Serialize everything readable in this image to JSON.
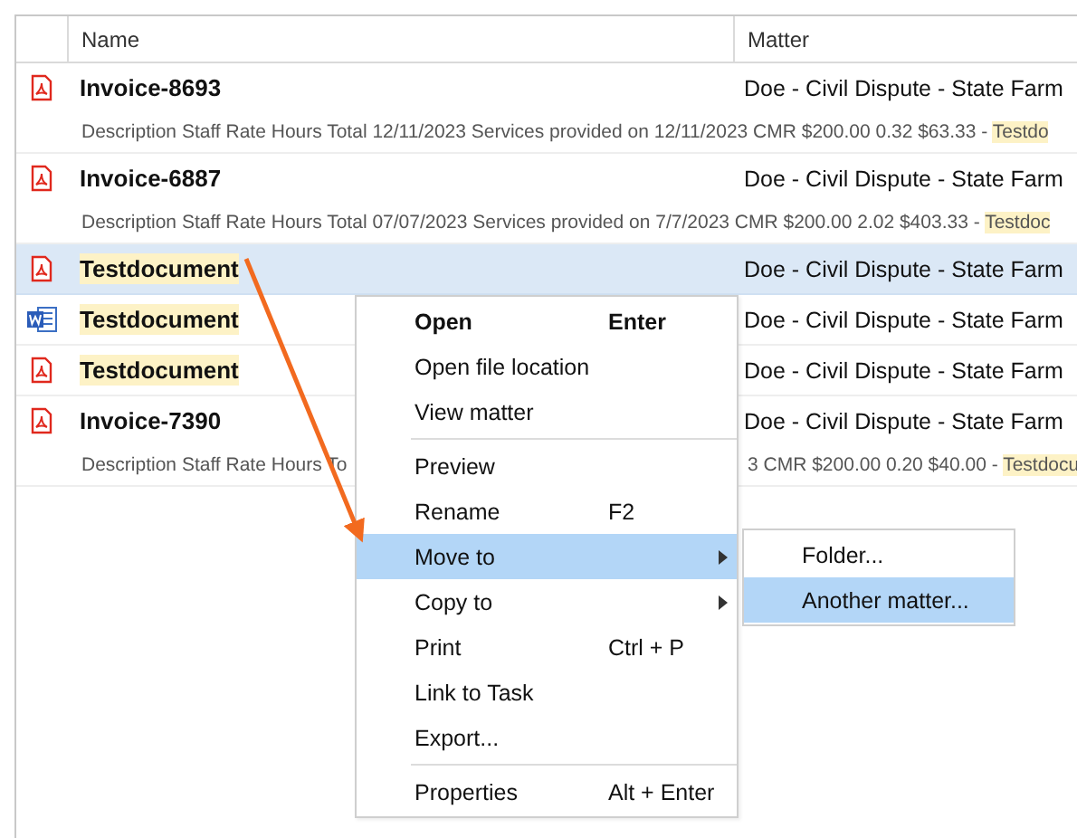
{
  "table": {
    "columns": [
      {
        "label": "Name"
      },
      {
        "label": "Matter"
      }
    ],
    "rows": [
      {
        "kind": "pdf",
        "name": "Invoice-8693",
        "highlighted": false,
        "selected": false,
        "matter": "Doe - Civil Dispute - State Farm",
        "description": [
          {
            "text": "Description Staff Rate Hours Total 12/11/2023 Services provided on 12/11/2023 CMR $200.00 0.32 $63.33 - ",
            "highlight": "Testdo"
          }
        ]
      },
      {
        "kind": "pdf",
        "name": "Invoice-6887",
        "highlighted": false,
        "selected": false,
        "matter": "Doe - Civil Dispute - State Farm",
        "description": [
          {
            "text": "Description Staff Rate Hours Total 07/07/2023 Services provided on 7/7/2023 CMR $200.00 2.02 $403.33 - ",
            "highlight": "Testdoc"
          }
        ]
      },
      {
        "kind": "pdf",
        "name": "Testdocument",
        "highlighted": true,
        "selected": true,
        "matter": "Doe - Civil Dispute - State Farm"
      },
      {
        "kind": "word",
        "name": "Testdocument",
        "highlighted": true,
        "selected": false,
        "matter": "Doe - Civil Dispute - State Farm"
      },
      {
        "kind": "pdf",
        "name": "Testdocument",
        "highlighted": true,
        "selected": false,
        "matter": "Doe - Civil Dispute - State Farm"
      },
      {
        "kind": "pdf",
        "name": "Invoice-7390",
        "highlighted": false,
        "selected": false,
        "matter": "Doe - Civil Dispute - State Farm",
        "description": [
          {
            "text": "Description Staff Rate Hours To"
          },
          {
            "text": "3 CMR $200.00 0.20 $40.00 - ",
            "highlight": "Testdocu"
          }
        ]
      }
    ]
  },
  "context_menu": {
    "items": [
      {
        "kind": "item",
        "label": "Open",
        "shortcut": "Enter",
        "default": true,
        "selected": false
      },
      {
        "kind": "item",
        "label": "Open file location",
        "selected": false
      },
      {
        "kind": "item",
        "label": "View matter",
        "selected": false
      },
      {
        "kind": "separator"
      },
      {
        "kind": "item",
        "label": "Preview",
        "selected": false
      },
      {
        "kind": "item",
        "label": "Rename",
        "shortcut": "F2",
        "selected": false
      },
      {
        "kind": "item",
        "label": "Move to",
        "submenu": true,
        "selected": true
      },
      {
        "kind": "item",
        "label": "Copy to",
        "submenu": true,
        "selected": false
      },
      {
        "kind": "item",
        "label": "Print",
        "shortcut": "Ctrl + P",
        "selected": false
      },
      {
        "kind": "item",
        "label": "Link to Task",
        "selected": false
      },
      {
        "kind": "item",
        "label": "Export...",
        "selected": false
      },
      {
        "kind": "separator"
      },
      {
        "kind": "item",
        "label": "Properties",
        "shortcut": "Alt + Enter",
        "selected": false
      }
    ]
  },
  "submenu": {
    "items": [
      {
        "label": "Folder...",
        "selected": false
      },
      {
        "label": "Another matter...",
        "selected": true
      }
    ]
  }
}
